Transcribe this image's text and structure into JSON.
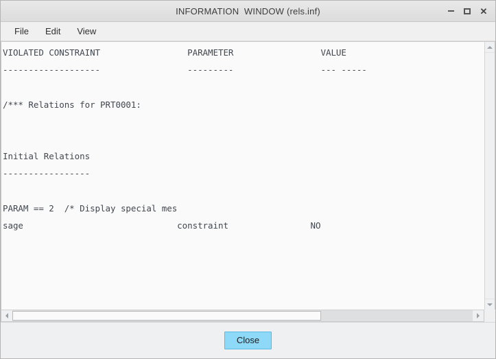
{
  "window": {
    "title": "INFORMATION  WINDOW (rels.inf)",
    "controls": {
      "minimize": "–",
      "maximize": "□",
      "close": "✕"
    }
  },
  "menubar": {
    "items": [
      {
        "label": "File"
      },
      {
        "label": "Edit"
      },
      {
        "label": "View"
      }
    ]
  },
  "content": {
    "lines": [
      "VIOLATED CONSTRAINT                 PARAMETER                 VALUE",
      "-------------------                 ---------                 --- -----",
      "",
      "/*** Relations for PRT0001:",
      "",
      "",
      "Initial Relations",
      "-----------------",
      "",
      "PARAM == 2  /* Display special mes",
      "sage                              constraint                NO"
    ]
  },
  "scrollbars": {
    "vertical": {
      "up_arrow": "▲",
      "down_arrow": "▼"
    },
    "horizontal": {
      "left_arrow": "◀",
      "right_arrow": "▶"
    }
  },
  "footer": {
    "close_label": "Close"
  },
  "colors": {
    "accent": "#8ed8f8",
    "accent_border": "#5bb8e0",
    "text": "#41474f",
    "chrome": "#f0f0f0",
    "editor_bg": "#fafafa"
  }
}
